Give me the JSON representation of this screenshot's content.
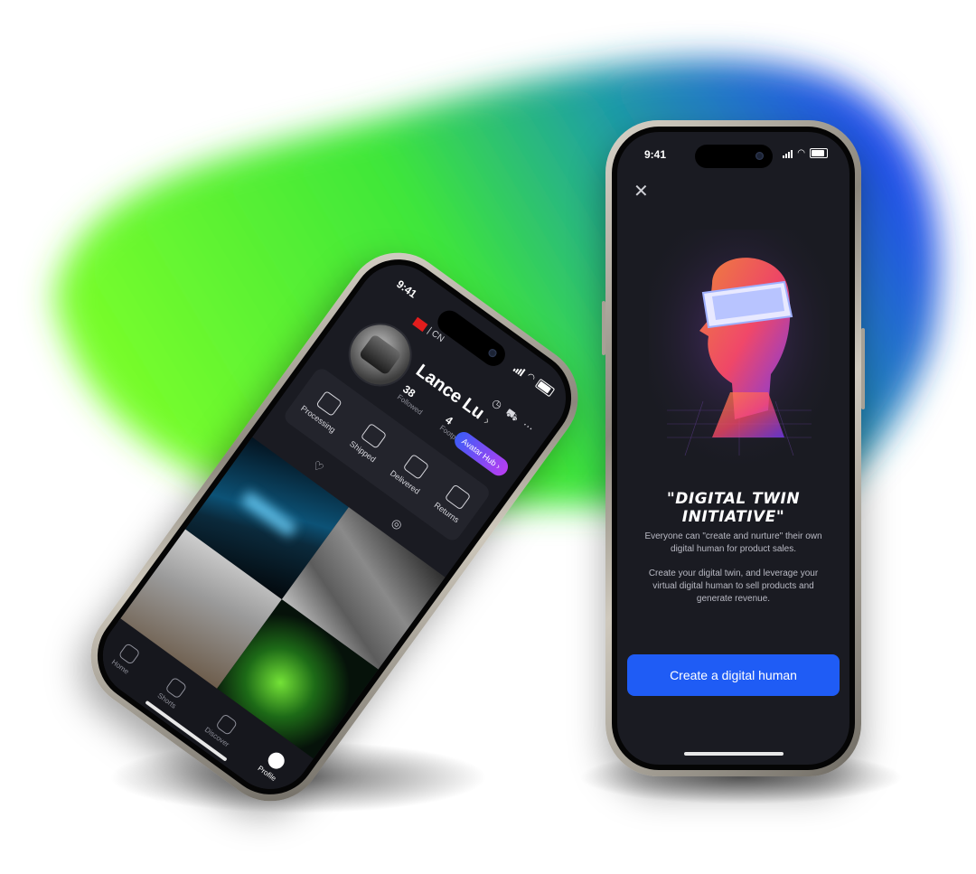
{
  "left_phone": {
    "status_time": "9:41",
    "region": "| CN",
    "profile": {
      "name": "Lance Lu",
      "chevron": "›",
      "stats": [
        {
          "value": "38",
          "label": "Followed"
        },
        {
          "value": "4",
          "label": "Footprints"
        }
      ],
      "avatar_hub_label": "Avatar Hub ›"
    },
    "orders": [
      {
        "label": "Processing",
        "icon": "package-icon"
      },
      {
        "label": "Shipped",
        "icon": "truck-icon"
      },
      {
        "label": "Delivered",
        "icon": "box-icon"
      },
      {
        "label": "Returns",
        "icon": "return-icon"
      }
    ],
    "tabs": [
      "♡",
      "◎"
    ],
    "nav": [
      {
        "label": "Home",
        "icon": "home-icon"
      },
      {
        "label": "Shorts",
        "icon": "play-icon"
      },
      {
        "label": "Discover",
        "icon": "discover-icon"
      },
      {
        "label": "Profile",
        "icon": "profile-icon"
      }
    ]
  },
  "right_phone": {
    "status_time": "9:41",
    "title": "\"DIGITAL TWIN INITIATIVE\"",
    "description": "Everyone can \"create and nurture\" their own digital human for product sales.",
    "description2": "Create your digital twin, and leverage your virtual digital human to sell products and generate revenue.",
    "cta_label": "Create a digital human",
    "close_icon": "close-icon",
    "accent": "#1f5cf5"
  }
}
